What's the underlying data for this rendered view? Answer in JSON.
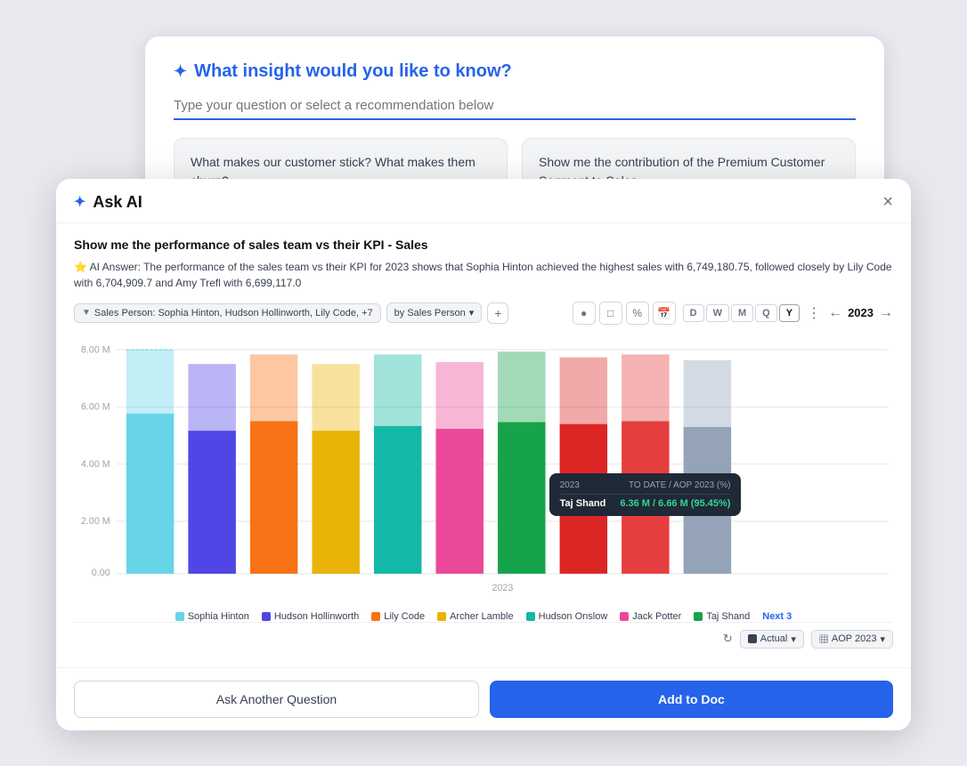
{
  "recommendation_card": {
    "title": "What insight would you like to know?",
    "input_placeholder": "Type your question or select a recommendation below",
    "suggestions": [
      {
        "id": "suggestion-1",
        "text": "What makes our customer stick? What makes them churn?"
      },
      {
        "id": "suggestion-2",
        "text": "Show me the contribution of the Premium Customer Segment to Sales"
      }
    ]
  },
  "modal": {
    "title": "Ask AI",
    "close_label": "×"
  },
  "chart": {
    "query": "Show me the performance of sales team vs their KPI - Sales",
    "ai_prefix": "⭐",
    "ai_answer": "AI Answer: The performance of the sales team vs their KPI for 2023 shows that Sophia Hinton achieved the highest sales with 6,749,180.75, followed closely by Lily Code with 6,704,909.7 and Amy Trefl with 6,699,117.0",
    "filter_tag": "Sales Person: Sophia Hinton, Hudson Hollinworth, Lily Code, +7",
    "by_person_label": "by Sales Person",
    "year": "2023",
    "x_axis_label": "2023",
    "y_axis_labels": [
      "8.00 M",
      "6.00 M",
      "4.00 M",
      "2.00 M",
      "0.00"
    ],
    "tooltip": {
      "header_left": "2023",
      "header_right": "TO DATE / AOP 2023 (%)",
      "name": "Taj Shand",
      "value": "6.36 M / 6.66 M (95.45%)"
    },
    "legend": [
      {
        "name": "Sophia Hinton",
        "color": "#67d4e8"
      },
      {
        "name": "Hudson Hollinworth",
        "color": "#4f46e5"
      },
      {
        "name": "Lily Code",
        "color": "#f97316"
      },
      {
        "name": "Archer Lamble",
        "color": "#eab308"
      },
      {
        "name": "Hudson Onslow",
        "color": "#14b8a6"
      },
      {
        "name": "Jack Potter",
        "color": "#ec4899"
      },
      {
        "name": "Taj Shand",
        "color": "#16a34a"
      }
    ],
    "legend_next": "Next 3",
    "period_buttons": [
      "D",
      "W",
      "M",
      "Q",
      "Y"
    ],
    "active_period": "Y",
    "footer": {
      "actual_label": "Actual",
      "aop_label": "AOP 2023"
    }
  },
  "actions": {
    "ask_another": "Ask Another Question",
    "add_to_doc": "Add to Doc"
  }
}
